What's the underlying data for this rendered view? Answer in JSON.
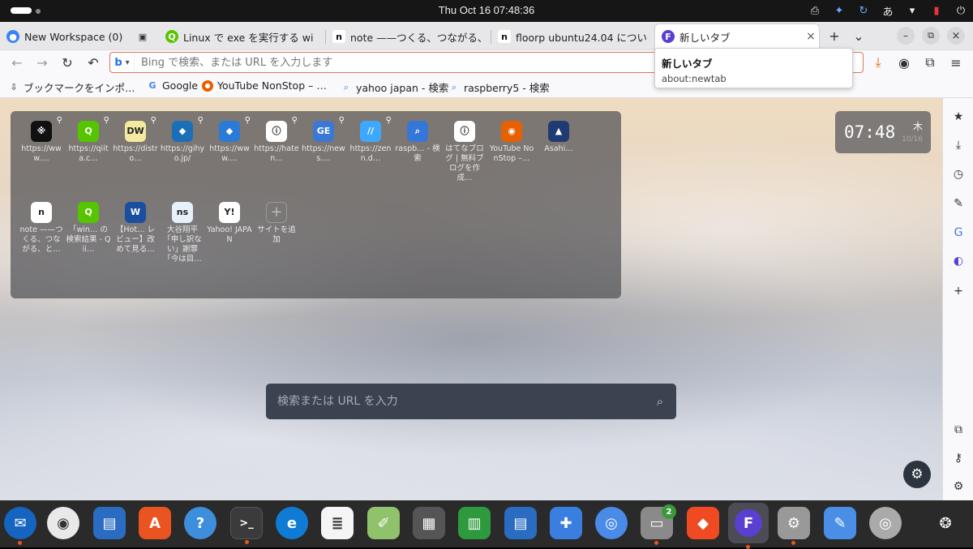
{
  "topbar": {
    "clock": "Thu Oct 16  07:48:36",
    "input_method": "あ"
  },
  "tabs": [
    {
      "label": "New Workspace (0)",
      "icon": "workspace-icon"
    },
    {
      "label": "Linux で exe を実行する wi",
      "icon": "qiita-icon"
    },
    {
      "label": "note ——つくる、つながる、",
      "icon": "note-icon"
    },
    {
      "label": "floorp ubuntu24.04 につい",
      "icon": "note-icon"
    },
    {
      "label": "新しいタブ",
      "icon": "floorp-icon",
      "close": "×"
    }
  ],
  "tab_controls": {
    "new_tab": "+",
    "list": "⌄",
    "minimize": "–",
    "restore": "⧉",
    "close": "×"
  },
  "urlbar": {
    "engine": "b",
    "placeholder": "Bing で検索、または URL を入力します",
    "value": ""
  },
  "bookmarks": [
    {
      "label": "ブックマークをインポ…",
      "icon": "import-icon"
    },
    {
      "label": "Google",
      "icon": "google-icon"
    },
    {
      "label": "YouTube NonStop – …",
      "icon": "firefox-icon"
    },
    {
      "label": "yahoo japan - 検索",
      "icon": "search-icon"
    },
    {
      "label": "raspberry5 - 検索",
      "icon": "search-icon"
    }
  ],
  "popup": {
    "title": "新しいタブ",
    "url": "about:newtab"
  },
  "sites_row1": [
    {
      "label": "https://www.…",
      "icon_text": "※",
      "color": "#111"
    },
    {
      "label": "https://qiita.c…",
      "icon_text": "Q",
      "color": "#55c500"
    },
    {
      "label": "https://distro…",
      "icon_text": "DW",
      "color": "#f3e9a0"
    },
    {
      "label": "https://gihyo.jp/",
      "icon_text": "◆",
      "color": "#1b6fb8"
    },
    {
      "label": "https://www.…",
      "icon_text": "◆",
      "color": "#2b7bd6"
    },
    {
      "label": "https://haten…",
      "icon_text": "ⓘ",
      "color": "#fff"
    },
    {
      "label": "https://news.…",
      "icon_text": "GE",
      "color": "#3a78d4"
    },
    {
      "label": "https://zenn.d…",
      "icon_text": "//",
      "color": "#3ea8ff"
    },
    {
      "label": "raspb… - 検索",
      "icon_text": "⌕",
      "color": "#3477d8"
    },
    {
      "label": "はてなブログ | 無料ブログを作成…",
      "icon_text": "ⓘ",
      "color": "#fff"
    },
    {
      "label": "YouTube NonStop –…",
      "icon_text": "◉",
      "color": "#e66000"
    },
    {
      "label": "Asahi…",
      "icon_text": "▲",
      "color": "#1f3b73"
    }
  ],
  "sites_row2": [
    {
      "label": "note ——つくる、つながる、と…",
      "icon_text": "n",
      "color": "#fff"
    },
    {
      "label": "「win… の検索結果 - Qii…",
      "icon_text": "Q",
      "color": "#55c500"
    },
    {
      "label": "【Hot… レビュー】改めて見る…",
      "icon_text": "W",
      "color": "#1a4fa0"
    },
    {
      "label": "大谷翔平「申し訳ない」謝罪「今は目…",
      "icon_text": "ns",
      "color": "#e8f0fa"
    },
    {
      "label": "Yahoo! JAPAN",
      "icon_text": "Y!",
      "color": "#fff"
    },
    {
      "label": "サイトを追加",
      "icon_text": "+",
      "color": "transparent"
    }
  ],
  "clock_widget": {
    "time": "07:48",
    "weekday": "木",
    "date": "10/16"
  },
  "newtab_search": {
    "placeholder": "検索または URL を入力"
  },
  "dock": {
    "files_badge": "2"
  }
}
